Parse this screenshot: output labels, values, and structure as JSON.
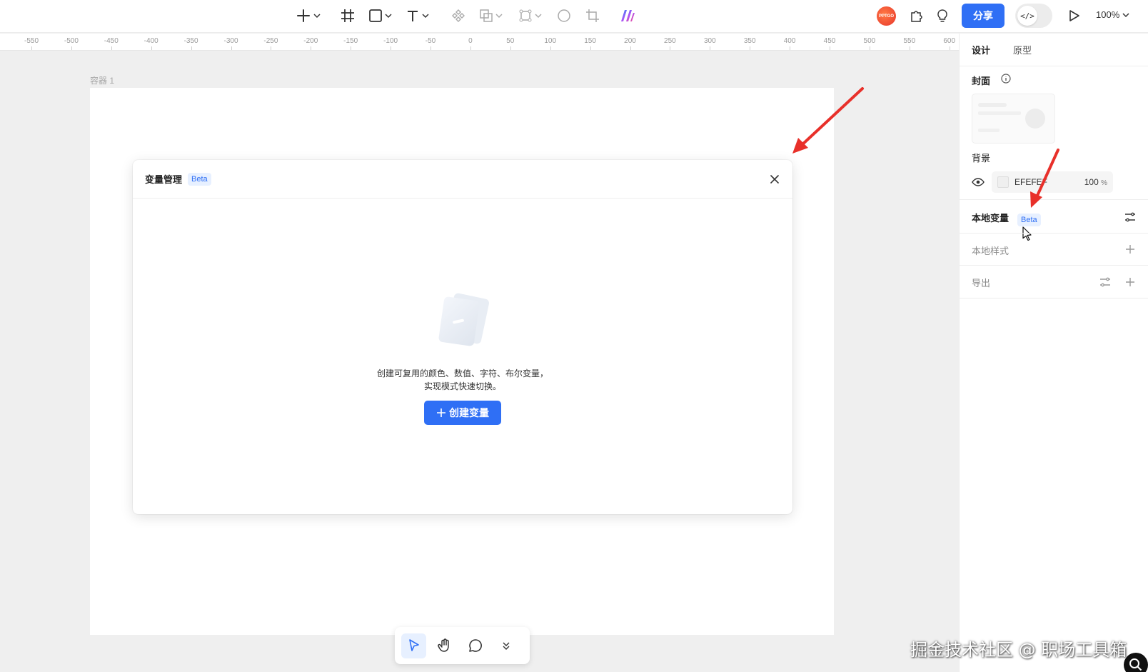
{
  "toolbar": {
    "zoom_label": "100%",
    "share_label": "分享",
    "avatar_text": "PPTGO",
    "dev_mode_glyph": "</>"
  },
  "ruler": {
    "ticks": [
      "-550",
      "-500",
      "-450",
      "-400",
      "-350",
      "-300",
      "-250",
      "-200",
      "-150",
      "-100",
      "-50",
      "0",
      "50",
      "100",
      "150",
      "200",
      "250",
      "300",
      "350",
      "400",
      "450",
      "500",
      "550",
      "600"
    ]
  },
  "canvas": {
    "frame_label": "容器 1"
  },
  "modal": {
    "title": "变量管理",
    "beta_badge": "Beta",
    "empty_line1": "创建可复用的颜色、数值、字符、布尔变量，",
    "empty_line2": "实现模式快速切换。",
    "create_button": "创建变量"
  },
  "panel": {
    "tabs": [
      "设计",
      "原型"
    ],
    "cover_label": "封面",
    "background_label": "背景",
    "background_color": "EFEFEF",
    "background_opacity": "100",
    "opacity_unit": "%",
    "local_variables_label": "本地变量",
    "local_variables_badge": "Beta",
    "local_styles_label": "本地样式",
    "export_label": "导出"
  },
  "watermark": "掘金技术社区 @ 职场工具箱",
  "colors": {
    "accent": "#2F6FF5",
    "canvas_bg": "#EFEFEF",
    "annotation_arrow": "#E8302A"
  }
}
